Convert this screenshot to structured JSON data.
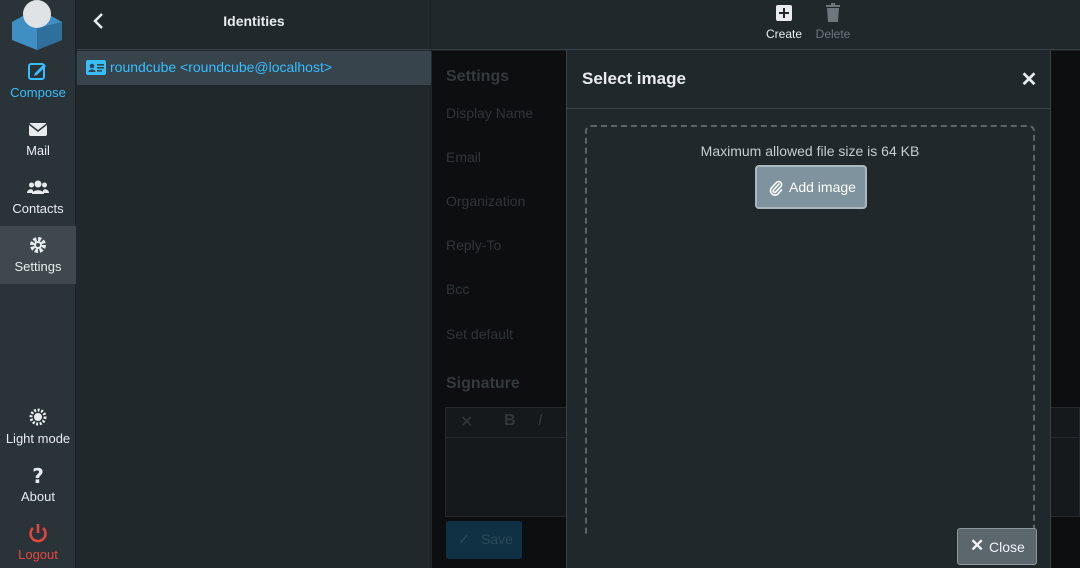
{
  "nav": {
    "items": [
      {
        "label": "Compose",
        "icon": "compose-icon"
      },
      {
        "label": "Mail",
        "icon": "mail-icon"
      },
      {
        "label": "Contacts",
        "icon": "contacts-icon"
      },
      {
        "label": "Settings",
        "icon": "gear-icon"
      },
      {
        "label": "Light mode",
        "icon": "sun-icon"
      },
      {
        "label": "About",
        "icon": "question-icon"
      },
      {
        "label": "Logout",
        "icon": "power-icon"
      }
    ]
  },
  "list": {
    "title": "Identities",
    "identity": "roundcube <roundcube@localhost>"
  },
  "toolbar": {
    "create_label": "Create",
    "delete_label": "Delete"
  },
  "form": {
    "section_settings": "Settings",
    "display_name": "Display Name",
    "email": "Email",
    "organization": "Organization",
    "reply_to": "Reply-To",
    "bcc": "Bcc",
    "set_default": "Set default",
    "section_signature": "Signature",
    "save_label": "Save"
  },
  "dialog": {
    "title": "Select image",
    "limit_text": "Maximum allowed file size is 64 KB",
    "add_label": "Add image",
    "close_label": "Close"
  },
  "colors": {
    "accent": "#37beff",
    "logout": "#e5473f",
    "background": "#21282c"
  }
}
